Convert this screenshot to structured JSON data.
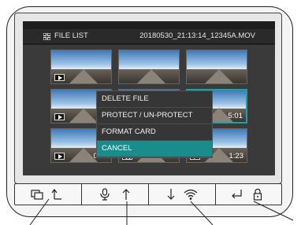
{
  "header": {
    "title": "FILE LIST",
    "filename": "20180530_21:13:14_12345A.MOV"
  },
  "thumbnails": [
    {
      "type": "video",
      "duration": ""
    },
    {
      "type": "video",
      "duration": ""
    },
    {
      "type": "video",
      "duration": ""
    },
    {
      "type": "video",
      "duration": ""
    },
    {
      "type": "video",
      "duration": ""
    },
    {
      "type": "video",
      "duration": "5:01",
      "selected": true
    },
    {
      "type": "video",
      "duration": "0:23"
    },
    {
      "type": "photo",
      "duration": ""
    },
    {
      "type": "video",
      "duration": "1:23"
    }
  ],
  "menu": {
    "items": [
      "DELETE FILE",
      "PROTECT / UN-PROTECT",
      "FORMAT CARD",
      "CANCEL"
    ],
    "active": "CANCEL"
  },
  "buttons": [
    {
      "icons": [
        "screen-switch-icon",
        "return-up-icon"
      ]
    },
    {
      "icons": [
        "microphone-icon",
        "up-arrow-icon"
      ]
    },
    {
      "icons": [
        "down-arrow-icon",
        "wifi-icon"
      ]
    },
    {
      "icons": [
        "enter-icon",
        "lock-icon"
      ]
    }
  ],
  "colors": {
    "accent": "#1a8c8c",
    "selection_border": "#1aa3a3"
  }
}
